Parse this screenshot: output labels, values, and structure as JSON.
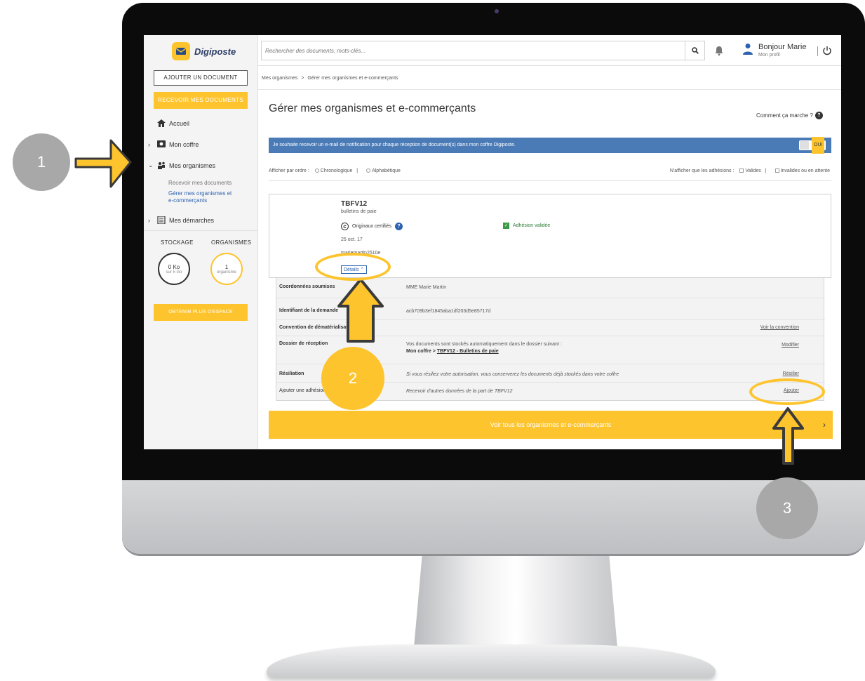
{
  "app": {
    "logo_text": "Digiposte",
    "search_placeholder": "Rechercher des documents, mots-clés...",
    "greeting": "Bonjour Marie",
    "profile_link": "Mon profil"
  },
  "sidebar": {
    "add_document": "AJOUTER UN DOCUMENT",
    "receive_documents": "RECEVOIR MES DOCUMENTS",
    "nav": {
      "home": "Accueil",
      "safe": "Mon coffre",
      "organizations": "Mes organismes",
      "sub_receive": "Recevoir mes documents",
      "sub_manage_1": "Gérer mes organismes et",
      "sub_manage_2": "e-commerçants",
      "procedures": "Mes démarches"
    },
    "storage_label": "STOCKAGE",
    "orgs_label": "ORGANISMES",
    "storage_value": "0 Ko",
    "storage_total": "sur 5 Go",
    "orgs_value": "1",
    "orgs_unit": "organisme",
    "more_space": "OBTENIR PLUS D'ESPACE"
  },
  "breadcrumb": {
    "parent": "Mes organismes",
    "separator": ">",
    "current": "Gérer mes organismes et e-commerçants"
  },
  "main": {
    "title": "Gérer mes organismes et e-commerçants",
    "help": "Comment ça marche ?",
    "notification_text": "Je souhaite recevoir un e-mail de notification pour chaque réception de document(s) dans mon coffre Digiposte.",
    "notification_toggle": "OUI",
    "filters": {
      "order_label": "Afficher par ordre :",
      "chrono": "Chronologique",
      "alpha": "Alphabétique",
      "show_label": "N'afficher que les adhésions :",
      "valid": "Valides",
      "invalid": "Invalides ou en attente",
      "sep": "|"
    },
    "card": {
      "name": "TBFV12",
      "subtitle": "bulletins de paie",
      "certified": "Originaux certifiés",
      "status": "Adhésion validée",
      "date": "25 oct. 17",
      "identifier": "mariemartin2510e",
      "details_button": "Détails"
    },
    "details": {
      "coords_label": "Coordonnées soumises",
      "coords_value": "MME Marie Martin",
      "request_label": "Identifiant de la demande",
      "request_value": "acb709b3ef1845aba1df203d5e85717d",
      "convention_label": "Convention de dématérialisation",
      "convention_link": "Voir la convention",
      "folder_label": "Dossier de réception",
      "folder_text": "Vos documents sont stockés automatiquement dans le dossier suivant :",
      "folder_path_1": "Mon coffre",
      "folder_path_sep": ">",
      "folder_path_2": "TBFV12 - Bulletins de paie",
      "folder_link": "Modifier",
      "termination_label": "Résiliation",
      "termination_text": "Si vous résiliez votre autorisation, vous conserverez les documents déjà stockés dans votre coffre",
      "termination_link": "Résilier",
      "add_label": "Ajouter une adhésion",
      "add_text": "Recevoir d'autres données de la part de TBFV12",
      "add_link": "Ajouter"
    },
    "see_all": "Voir tous les organismes et e-commerçants",
    "see_all_chevron": "›"
  },
  "annotations": {
    "step1": "1",
    "step2": "2",
    "step3": "3"
  },
  "colors": {
    "accent_yellow": "#fec42d",
    "notif_blue": "#4a7bb7",
    "link_blue": "#2c62b0",
    "annotation_grey": "#a8a8a8"
  }
}
